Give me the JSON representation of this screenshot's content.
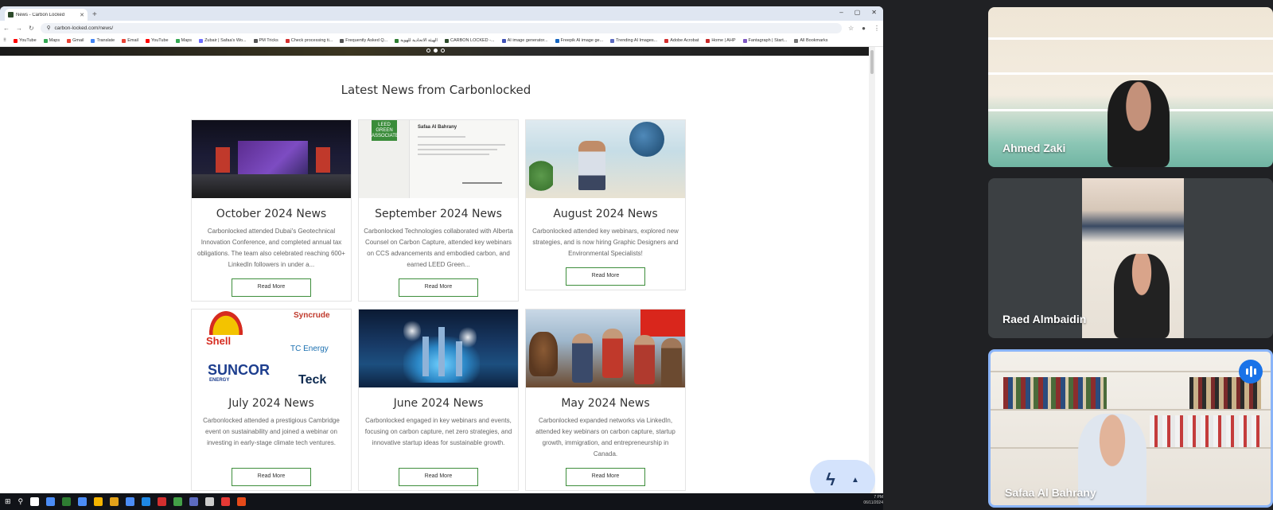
{
  "browser": {
    "tab_title": "News - Carbon Locked",
    "url": "carbon-locked.com/news/",
    "bookmarks": [
      "YouTube",
      "Maps",
      "Gmail",
      "Translate",
      "Email",
      "YouTube",
      "Maps",
      "Zubair | Safaa's Wo...",
      "PM Tricks",
      "Check processing ti...",
      "Frequently Asked Q...",
      "الهيئة الاتحادية للهوية",
      "CARBON LOCKED -...",
      "AI image generator...",
      "Freepik AI image ge...",
      "Trending AI Images...",
      "Adobe Acrobat",
      "Home | AHP",
      "Fantagraph | Start...",
      "All Bookmarks"
    ],
    "bookmark_colors": [
      "#ff0000",
      "#34a853",
      "#ea4335",
      "#4285f4",
      "#ea4335",
      "#ff0000",
      "#34a853",
      "#6c6cff",
      "#555555",
      "#d32f2f",
      "#555555",
      "#2e7d32",
      "#2d4a2b",
      "#3f51b5",
      "#1565c0",
      "#5c6bc0",
      "#d32f2f",
      "#c62828",
      "#7e57c2",
      "#777777"
    ]
  },
  "page": {
    "section_title": "Latest News from Carbonlocked",
    "read_more": "Read More"
  },
  "cards": [
    {
      "title": "October 2024 News",
      "summary": "Carbonlocked attended Dubai's Geotechnical Innovation Conference, and completed annual tax obligations. The team also celebrated reaching 600+ LinkedIn followers in under a..."
    },
    {
      "title": "September 2024 News",
      "summary": "Carbonlocked Technologies collaborated with Alberta Counsel on Carbon Capture, attended key webinars on CCS advancements and embodied carbon, and earned LEED Green...",
      "cert_name": "Safaa Al Bahrany",
      "cert_badge": "LEED GREEN ASSOCIATE"
    },
    {
      "title": "August 2024 News",
      "summary": "Carbonlocked attended key webinars, explored new strategies, and is now hiring Graphic Designers and Environmental Specialists!"
    },
    {
      "title": "July 2024 News",
      "summary": "Carbonlocked attended a prestigious Cambridge event on sustainability and joined a webinar on investing in early-stage climate tech ventures.",
      "logos": [
        "Shell",
        "Syncrude",
        "TC Energy",
        "SUNCOR",
        "ENERGY",
        "Teck"
      ]
    },
    {
      "title": "June 2024 News",
      "summary": "Carbonlocked engaged in key webinars and events, focusing on carbon capture, net zero strategies, and innovative startup ideas for sustainable growth."
    },
    {
      "title": "May 2024 News",
      "summary": "Carbonlocked expanded networks via LinkedIn, attended key webinars on carbon capture, startup growth, immigration, and entrepreneurship in Canada."
    }
  ],
  "taskbar": {
    "time": "7 PM",
    "date": "06/11/2024",
    "icon_colors": [
      "#ffffff",
      "#4c8df6",
      "#2e7d32",
      "#4c8df6",
      "#f4b400",
      "#e3a21a",
      "#4c8df6",
      "#1e88e5",
      "#d32f2f",
      "#43a047",
      "#5c6bc0",
      "#cccccc",
      "#e53935",
      "#e64a19"
    ]
  },
  "participants": [
    {
      "name": "Ahmed Zaki"
    },
    {
      "name": "Raed Almbaidin"
    },
    {
      "name": "Safaa Al Bahrany",
      "speaking": true
    }
  ],
  "colors": {
    "accent_green": "#3e8e3c",
    "meet_bg": "#202124",
    "speaking_blue": "#1a73e8"
  }
}
